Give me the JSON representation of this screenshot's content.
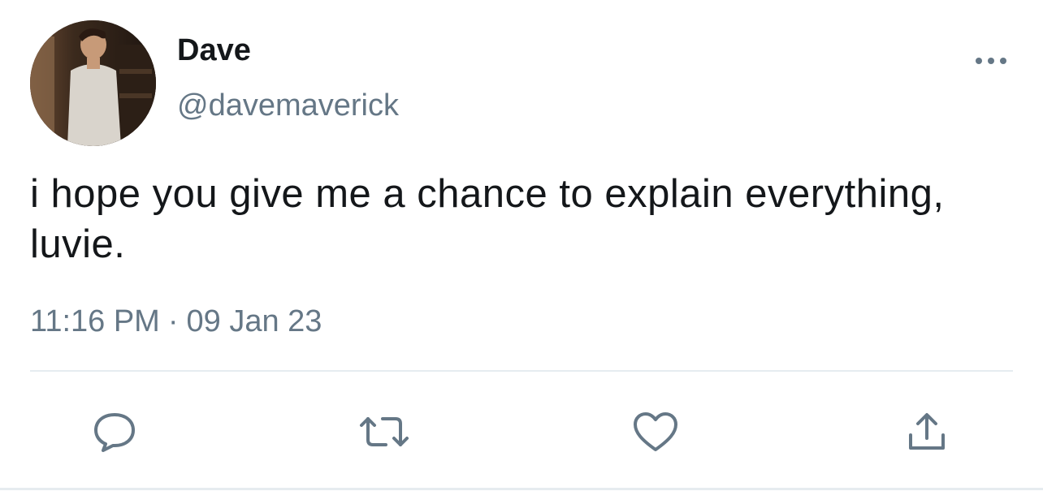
{
  "author": {
    "display_name": "Dave",
    "handle": "@davemaverick"
  },
  "tweet": {
    "text": "i hope you give me a chance to explain everything, luvie.",
    "time": "11:16 PM",
    "separator": "·",
    "date": "09 Jan 23"
  },
  "actions": {
    "reply_icon": "speech-bubble",
    "retweet_icon": "retweet-arrows",
    "like_icon": "heart",
    "share_icon": "upload-arrow"
  },
  "colors": {
    "text_primary": "#14171a",
    "text_secondary": "#657786",
    "divider": "#e6ecf0"
  }
}
